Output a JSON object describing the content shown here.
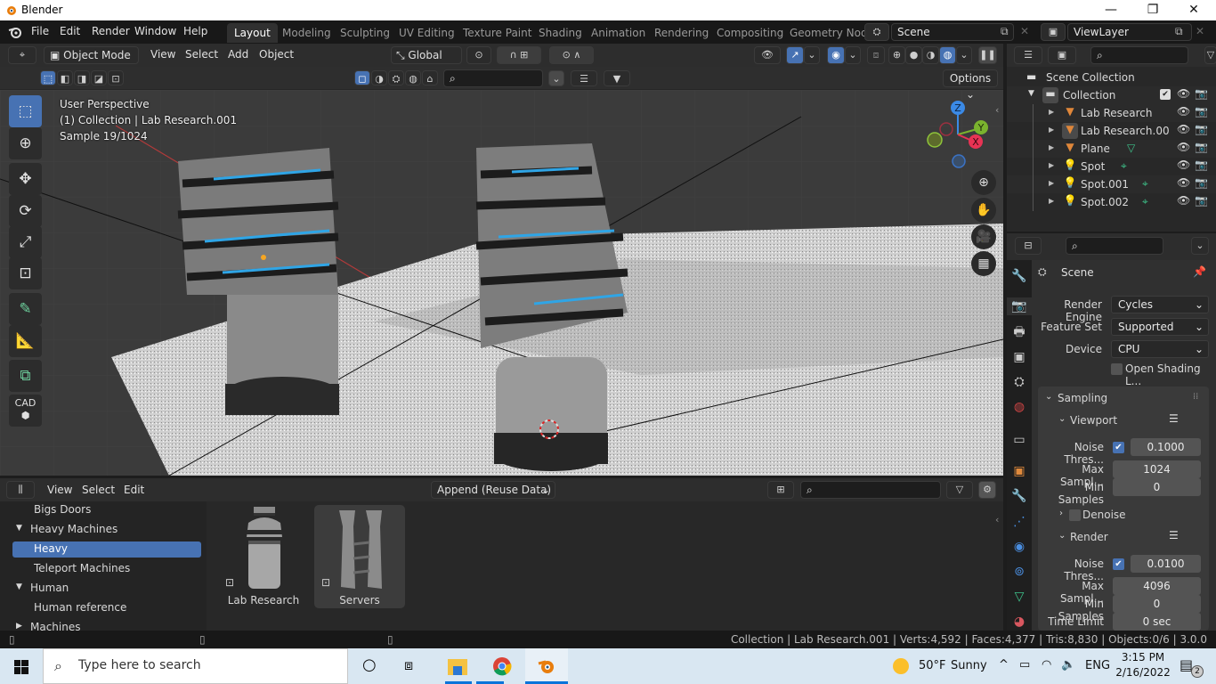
{
  "window": {
    "title": "Blender",
    "minimize": "—",
    "maximize": "❐",
    "close": "✕"
  },
  "topbar": {
    "menus": [
      "File",
      "Edit",
      "Render",
      "Window",
      "Help"
    ],
    "workspaces": [
      {
        "label": "Layout",
        "active": true
      },
      {
        "label": "Modeling"
      },
      {
        "label": "Sculpting"
      },
      {
        "label": "UV Editing"
      },
      {
        "label": "Texture Paint"
      },
      {
        "label": "Shading"
      },
      {
        "label": "Animation"
      },
      {
        "label": "Rendering"
      },
      {
        "label": "Compositing"
      },
      {
        "label": "Geometry Nod"
      }
    ],
    "scene": "Scene",
    "view_layer": "ViewLayer"
  },
  "viewport": {
    "mode": "Object Mode",
    "menus": [
      "View",
      "Select",
      "Add",
      "Object"
    ],
    "transform_orientation": "Global",
    "options_label": "Options",
    "overlay_lines": [
      "User Perspective",
      "(1) Collection | Lab Research.001",
      "Sample 19/1024"
    ],
    "gizmo": {
      "z": "Z",
      "y": "Y",
      "x": "X"
    },
    "accent": "#4772b3"
  },
  "outliner": {
    "root": "Scene Collection",
    "collection": "Collection",
    "items": [
      {
        "name": "Lab Research",
        "type": "mesh"
      },
      {
        "name": "Lab Research.00",
        "type": "mesh",
        "active": true
      },
      {
        "name": "Plane",
        "type": "mesh"
      },
      {
        "name": "Spot",
        "type": "light"
      },
      {
        "name": "Spot.001",
        "type": "light"
      },
      {
        "name": "Spot.002",
        "type": "light"
      }
    ]
  },
  "properties": {
    "context": "Scene",
    "render_engine_label": "Render Engine",
    "render_engine": "Cycles",
    "feature_set_label": "Feature Set",
    "feature_set": "Supported",
    "device_label": "Device",
    "device": "CPU",
    "osl_label": "Open Shading L...",
    "sampling_label": "Sampling",
    "viewport": {
      "label": "Viewport",
      "noise_label": "Noise Thres...",
      "noise_value": "0.1000",
      "max_label": "Max Sampl...",
      "max_value": "1024",
      "min_label": "Min Samples",
      "min_value": "0",
      "denoise_label": "Denoise"
    },
    "render": {
      "label": "Render",
      "noise_label": "Noise Thres...",
      "noise_value": "0.0100",
      "max_label": "Max Sampl...",
      "max_value": "4096",
      "min_label": "Min Samples",
      "min_value": "0",
      "time_label": "Time Limit",
      "time_value": "0 sec"
    }
  },
  "asset_browser": {
    "menus": [
      "View",
      "Select",
      "Edit"
    ],
    "import_mode": "Append (Reuse Data)",
    "tree": [
      {
        "label": "Bigs Doors",
        "level": 1
      },
      {
        "label": "Heavy Machines",
        "level": 0,
        "expanded": true
      },
      {
        "label": "Heavy",
        "level": 1,
        "selected": true
      },
      {
        "label": "Teleport Machines",
        "level": 1
      },
      {
        "label": "Human",
        "level": 0,
        "expanded": true
      },
      {
        "label": "Human reference",
        "level": 1
      },
      {
        "label": "Machines",
        "level": 0,
        "expanded": false
      }
    ],
    "assets": [
      {
        "label": "Lab Research"
      },
      {
        "label": "Servers"
      }
    ]
  },
  "statusbar": {
    "text": "Collection | Lab Research.001 | Verts:4,592 | Faces:4,377 | Tris:8,830 | Objects:0/6 | 3.0.0"
  },
  "taskbar": {
    "search_placeholder": "Type here to search",
    "weather_temp": "50°F",
    "weather_text": "Sunny",
    "language": "ENG",
    "time": "3:15 PM",
    "date": "2/16/2022",
    "notifications": "2"
  }
}
